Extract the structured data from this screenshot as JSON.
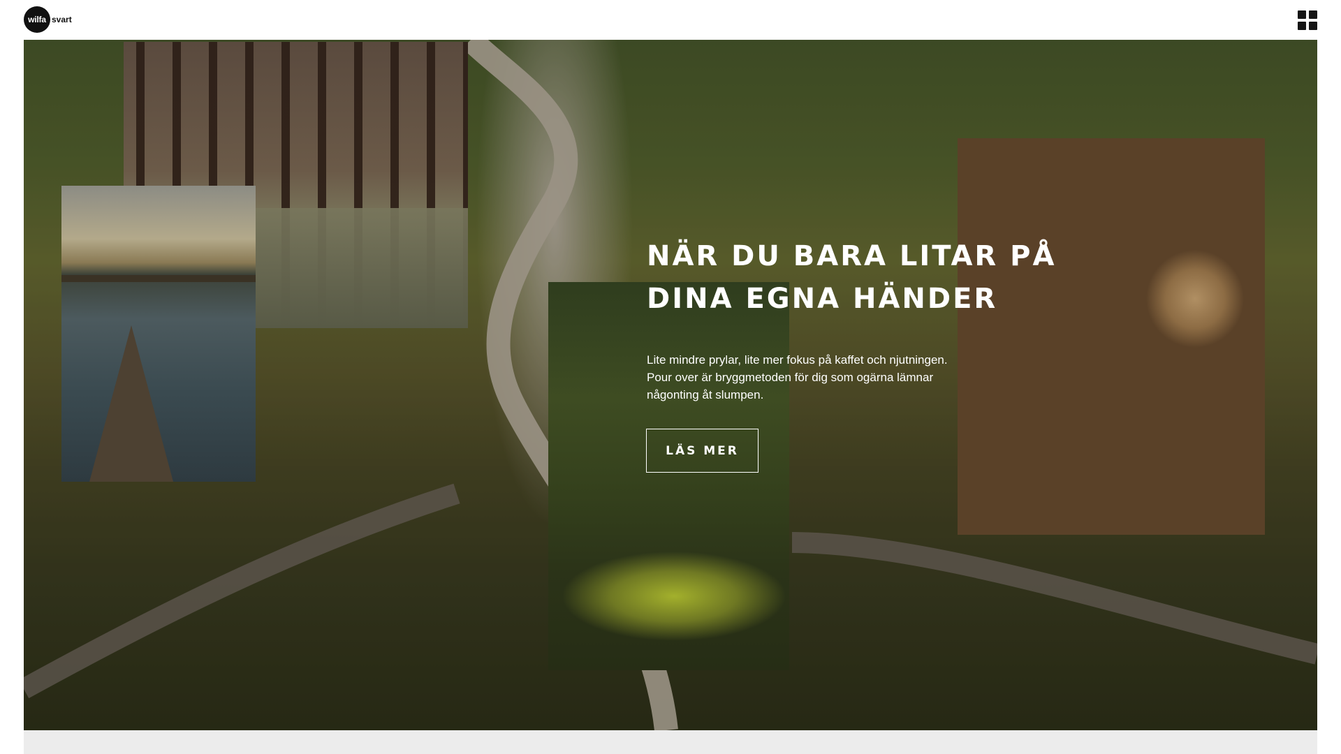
{
  "header": {
    "logo_text": "wilfa",
    "logo_sub": "svart",
    "menu_icon": "grid-menu-icon"
  },
  "hero": {
    "title": "NÄR DU BARA LITAR PÅ DINA EGNA HÄNDER",
    "description": "Lite mindre prylar, lite mer fokus på kaffet och njutningen. Pour over är bryggmetoden för dig som ogärna lämnar någonting åt slumpen.",
    "button_label": "LÄS MER",
    "images": [
      "forest-photo",
      "lake-dock-photo",
      "moss-forest-photo",
      "firewood-logs-photo"
    ]
  },
  "colors": {
    "text_on_hero": "#ffffff",
    "header_bg": "#ffffff",
    "bottom_strip": "#ececec"
  }
}
